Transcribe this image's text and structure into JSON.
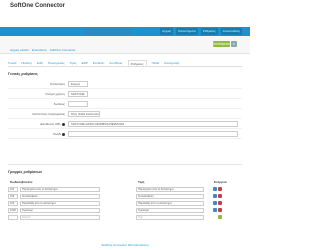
{
  "topbar": {
    "store_label": "",
    "items": [
      "Αρχική",
      "Καταστήματα",
      "Ρυθμίσεις",
      "Αποσύνδεση"
    ]
  },
  "header": {
    "title": "SoftOne Connector",
    "save_label": "Αποθήκευση",
    "cancel_icon": "close-icon",
    "breadcrumb": [
      "Αρχική σελίδα",
      "Επεκτάσεις",
      "SoftOne Connector"
    ]
  },
  "tabs": [
    "Γενικά",
    "Πελάτες",
    "Είδη",
    "Παραγγελίες",
    "Τιμές",
    "ERP",
    "Σύνδεση",
    "Αποθήκες",
    "Ρυθμίσεις",
    "Πεδία",
    "Καταγραφή"
  ],
  "active_tab_index": 8,
  "section_general": {
    "title": "Γενικές ρυθμίσεις",
    "fields": [
      {
        "label": "Κατάσταση",
        "value": "Ενεργό"
      },
      {
        "label": "Όνομα χρήστη",
        "value": "SOFTONE"
      },
      {
        "label": "Κωδικός",
        "value": ""
      },
      {
        "label": "Κατάσταση παραγγελίας",
        "value": "Όλες (Κάθε Κατάσταση)"
      },
      {
        "label": "Διεύθυνση URL",
        "value": "SOFTONE.OASIS.GR:8080/S1SERVICES"
      },
      {
        "label": "Κλειδί",
        "value": ""
      }
    ]
  },
  "section_lines": {
    "title": "Γραμμές ρυθμίσεων",
    "headers": [
      "Κωδικός",
      "Ετικέτα",
      "Τιμή",
      "Ενέργεια"
    ],
    "rows": [
      {
        "code": "101",
        "label": "Παραγγελία από το Κατάστημα",
        "value": "Παραγγελία από το Κατάστημα"
      },
      {
        "code": "102",
        "label": "Αντικαταβολή",
        "value": "Αντικαταβολή"
      },
      {
        "code": "103",
        "label": "Παραλαβή από το κατάστημα",
        "value": "Παραλαβή από το κατάστημα"
      },
      {
        "code": "1000",
        "label": "Τιμολόγιο",
        "value": "Τιμολόγιο"
      },
      {
        "code": "",
        "label": "Ετικέτα",
        "value": "Τιμή"
      }
    ]
  },
  "footer": {
    "text": "SoftOne Connector 2014 Επέκταση"
  },
  "colors": {
    "brand": "#1e91cf",
    "save": "#8fbb3c",
    "delete": "#c83f3f",
    "edit": "#3e8ac6"
  }
}
